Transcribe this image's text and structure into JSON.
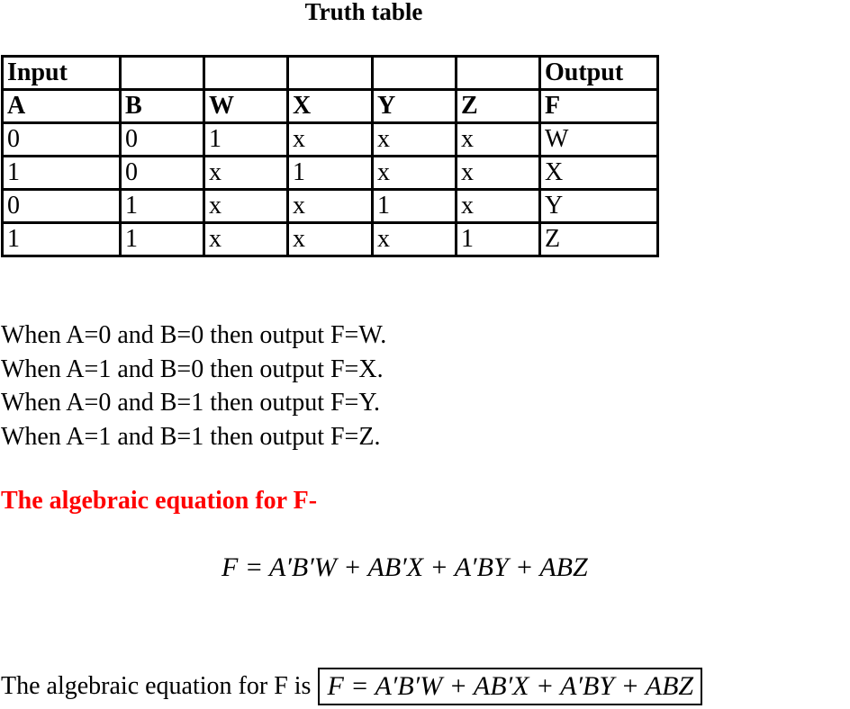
{
  "title": "Truth table",
  "table": {
    "group_row": [
      "Input",
      "",
      "",
      "",
      "",
      "",
      "Output"
    ],
    "header_row": [
      "A",
      "B",
      "W",
      "X",
      "Y",
      "Z",
      "F"
    ],
    "rows": [
      [
        "0",
        "0",
        "1",
        "x",
        "x",
        "x",
        "W"
      ],
      [
        "1",
        "0",
        "x",
        "1",
        "x",
        "x",
        "X"
      ],
      [
        "0",
        "1",
        "x",
        "x",
        "1",
        "x",
        "Y"
      ],
      [
        "1",
        "1",
        "x",
        "x",
        "x",
        "1",
        "Z"
      ]
    ]
  },
  "statements": [
    "When A=0 and B=0 then output F=W.",
    "When A=1 and B=0 then output F=X.",
    "When A=0 and B=1 then output F=Y.",
    "When A=1 and B=1 then output F=Z."
  ],
  "heading": {
    "text": "The algebraic equation for F-",
    "color": "#ff0000"
  },
  "equation": "F = A′B′W + AB′X + A′BY + ABZ",
  "final": {
    "prefix": "The algebraic equation for F is",
    "boxed_equation": "F = A′B′W + AB′X + A′BY + ABZ"
  }
}
